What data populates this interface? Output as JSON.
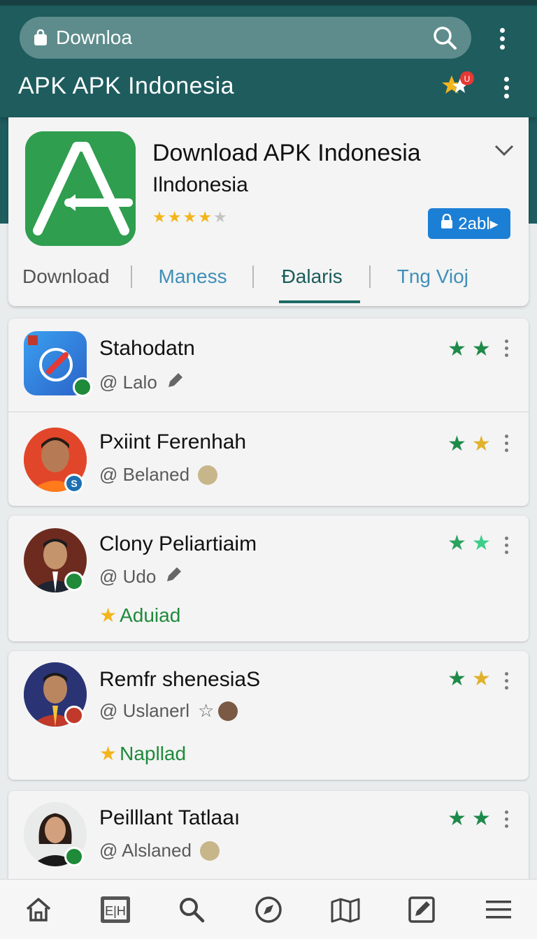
{
  "search": {
    "value": "Downloa"
  },
  "header": {
    "title": "APK  APK  Indonesia",
    "notification_badge": "U"
  },
  "hero": {
    "title": "Download APK Indonesia",
    "subtitle": "Ilndonesia",
    "rating": 4,
    "button_label": "2abl▸",
    "tabs": [
      {
        "label": "Download"
      },
      {
        "label": "Maness"
      },
      {
        "label": "Đalaris"
      },
      {
        "label": "Tng  Vioj"
      }
    ],
    "active_tab": 2
  },
  "list": [
    {
      "name": "Stahodatn",
      "handle": "@ Lalo",
      "badge_color": "#1e8a3a",
      "avatar": "app-icon"
    },
    {
      "name": "Pxiint Ferenhah",
      "handle": "@ Belaned",
      "badge_color": "#1c6fb0",
      "badge_text": "S",
      "avatar": "person"
    },
    {
      "name": "Clony Peliartiaim",
      "handle": "@ Udo",
      "badge_color": "#1e8a3a",
      "award": "Aduiad",
      "avatar": "person"
    },
    {
      "name": "Remfr shenesiaS",
      "handle": "@ Uslanerl",
      "badge_color": "#c0392b",
      "award": "Napllad",
      "avatar": "person"
    },
    {
      "name": "Peilllant Tatlaaı",
      "handle": "@ Alslaned",
      "badge_color": "#1e8a3a",
      "avatar": "person"
    }
  ],
  "colors": {
    "header": "#1e5c5e",
    "accent_blue": "#1c7fd6",
    "star_green": "#1e8a4a",
    "award_green": "#1e8a3a"
  },
  "bottom_nav": [
    "home-icon",
    "news-icon",
    "search-icon",
    "compass-icon",
    "map-icon",
    "edit-icon",
    "menu-icon"
  ]
}
